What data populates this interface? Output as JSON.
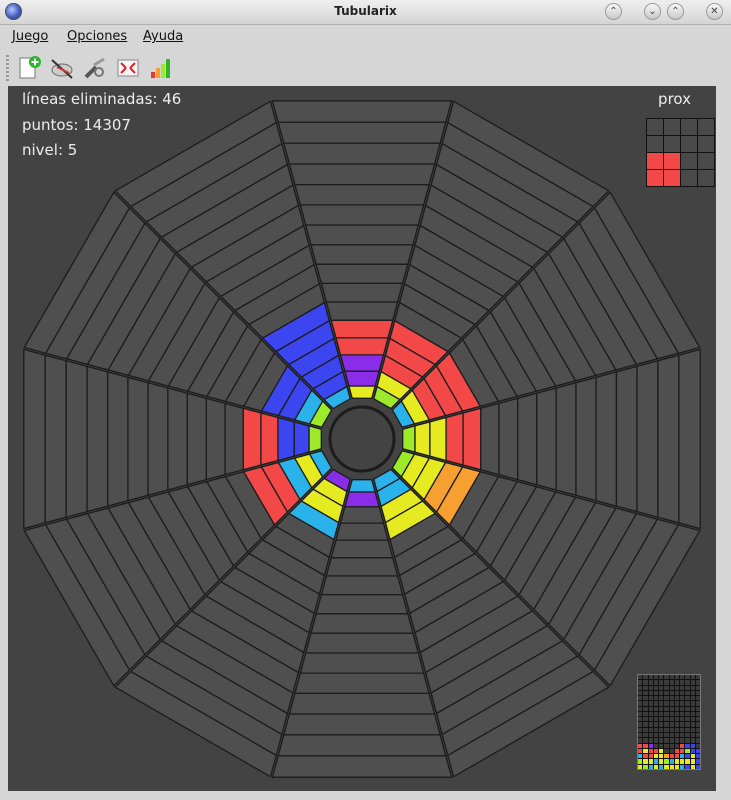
{
  "window": {
    "title": "Tubularix"
  },
  "menu": {
    "items": [
      "Juego",
      "Opciones",
      "Ayuda"
    ]
  },
  "toolbar": {
    "tools": [
      {
        "name": "new-game-icon"
      },
      {
        "name": "pause-icon"
      },
      {
        "name": "settings-icon"
      },
      {
        "name": "fullscreen-icon"
      },
      {
        "name": "highscores-icon"
      }
    ]
  },
  "stats": {
    "lines": "líneas eliminadas: 46",
    "points": "puntos: 14307",
    "level": "nivel: 5"
  },
  "next_piece": {
    "label": "prox",
    "grid": [
      [
        0,
        0,
        0,
        0
      ],
      [
        0,
        0,
        0,
        0
      ],
      [
        1,
        1,
        0,
        0
      ],
      [
        1,
        1,
        0,
        0
      ]
    ],
    "color": "#f24848"
  },
  "board": {
    "sectors": 12,
    "rings": 16,
    "palette": {
      "empty": "#4f4f4f",
      "red": "#f24848",
      "blue": "#3c46f0",
      "purple": "#8a2de8",
      "yellow": "#e6ea20",
      "lime": "#9cea2a",
      "cyan": "#2ab2ea",
      "orange": "#f5a030"
    },
    "filled": [
      {
        "sector": 0,
        "ring": 0,
        "color": "yellow"
      },
      {
        "sector": 0,
        "ring": 1,
        "color": "purple"
      },
      {
        "sector": 0,
        "ring": 2,
        "color": "purple"
      },
      {
        "sector": 0,
        "ring": 3,
        "color": "red"
      },
      {
        "sector": 0,
        "ring": 4,
        "color": "red"
      },
      {
        "sector": 1,
        "ring": 0,
        "color": "lime"
      },
      {
        "sector": 1,
        "ring": 1,
        "color": "yellow"
      },
      {
        "sector": 1,
        "ring": 2,
        "color": "red"
      },
      {
        "sector": 1,
        "ring": 3,
        "color": "red"
      },
      {
        "sector": 1,
        "ring": 4,
        "color": "red"
      },
      {
        "sector": 2,
        "ring": 0,
        "color": "cyan"
      },
      {
        "sector": 2,
        "ring": 1,
        "color": "yellow"
      },
      {
        "sector": 2,
        "ring": 2,
        "color": "red"
      },
      {
        "sector": 2,
        "ring": 3,
        "color": "red"
      },
      {
        "sector": 2,
        "ring": 4,
        "color": "red"
      },
      {
        "sector": 3,
        "ring": 0,
        "color": "lime"
      },
      {
        "sector": 3,
        "ring": 1,
        "color": "yellow"
      },
      {
        "sector": 3,
        "ring": 2,
        "color": "yellow"
      },
      {
        "sector": 3,
        "ring": 3,
        "color": "red"
      },
      {
        "sector": 3,
        "ring": 4,
        "color": "red"
      },
      {
        "sector": 4,
        "ring": 0,
        "color": "lime"
      },
      {
        "sector": 4,
        "ring": 1,
        "color": "yellow"
      },
      {
        "sector": 4,
        "ring": 2,
        "color": "yellow"
      },
      {
        "sector": 4,
        "ring": 3,
        "color": "orange"
      },
      {
        "sector": 4,
        "ring": 4,
        "color": "orange"
      },
      {
        "sector": 5,
        "ring": 0,
        "color": "cyan"
      },
      {
        "sector": 5,
        "ring": 1,
        "color": "cyan"
      },
      {
        "sector": 5,
        "ring": 2,
        "color": "yellow"
      },
      {
        "sector": 5,
        "ring": 3,
        "color": "yellow"
      },
      {
        "sector": 6,
        "ring": 0,
        "color": "cyan"
      },
      {
        "sector": 6,
        "ring": 1,
        "color": "purple"
      },
      {
        "sector": 7,
        "ring": 0,
        "color": "purple"
      },
      {
        "sector": 7,
        "ring": 1,
        "color": "yellow"
      },
      {
        "sector": 7,
        "ring": 2,
        "color": "yellow"
      },
      {
        "sector": 7,
        "ring": 3,
        "color": "cyan"
      },
      {
        "sector": 8,
        "ring": 0,
        "color": "cyan"
      },
      {
        "sector": 8,
        "ring": 1,
        "color": "yellow"
      },
      {
        "sector": 8,
        "ring": 2,
        "color": "cyan"
      },
      {
        "sector": 8,
        "ring": 3,
        "color": "red"
      },
      {
        "sector": 8,
        "ring": 4,
        "color": "red"
      },
      {
        "sector": 9,
        "ring": 0,
        "color": "lime"
      },
      {
        "sector": 9,
        "ring": 1,
        "color": "blue"
      },
      {
        "sector": 9,
        "ring": 2,
        "color": "blue"
      },
      {
        "sector": 9,
        "ring": 3,
        "color": "red"
      },
      {
        "sector": 9,
        "ring": 4,
        "color": "red"
      },
      {
        "sector": 10,
        "ring": 0,
        "color": "lime"
      },
      {
        "sector": 10,
        "ring": 1,
        "color": "cyan"
      },
      {
        "sector": 10,
        "ring": 2,
        "color": "blue"
      },
      {
        "sector": 10,
        "ring": 3,
        "color": "blue"
      },
      {
        "sector": 11,
        "ring": 0,
        "color": "cyan"
      },
      {
        "sector": 11,
        "ring": 1,
        "color": "blue"
      },
      {
        "sector": 11,
        "ring": 2,
        "color": "blue"
      },
      {
        "sector": 11,
        "ring": 3,
        "color": "blue"
      },
      {
        "sector": 11,
        "ring": 4,
        "color": "blue"
      },
      {
        "sector": 11,
        "ring": 5,
        "color": "blue"
      }
    ]
  },
  "mini_map": {
    "cols": 12,
    "rows": 18,
    "colors": [
      "#f24848",
      "#3c46f0",
      "#8a2de8",
      "#e6ea20",
      "#9cea2a",
      "#2ab2ea",
      "#f5a030"
    ],
    "bottom_rows": [
      [
        0,
        0,
        0,
        0,
        0,
        0,
        0,
        0,
        0,
        0,
        0,
        0
      ],
      [
        0,
        0,
        0,
        0,
        0,
        0,
        0,
        0,
        0,
        0,
        0,
        0
      ],
      [
        0,
        0,
        0,
        0,
        0,
        0,
        0,
        0,
        0,
        0,
        0,
        0
      ],
      [
        1,
        1,
        3,
        0,
        0,
        0,
        0,
        0,
        1,
        2,
        2,
        0
      ],
      [
        1,
        4,
        1,
        1,
        4,
        0,
        0,
        1,
        1,
        5,
        2,
        2
      ],
      [
        6,
        1,
        1,
        4,
        4,
        7,
        1,
        1,
        6,
        2,
        4,
        2
      ],
      [
        5,
        4,
        4,
        6,
        4,
        5,
        6,
        4,
        4,
        4,
        4,
        2
      ],
      [
        4,
        5,
        6,
        4,
        6,
        4,
        4,
        4,
        6,
        2,
        4,
        2
      ]
    ]
  }
}
